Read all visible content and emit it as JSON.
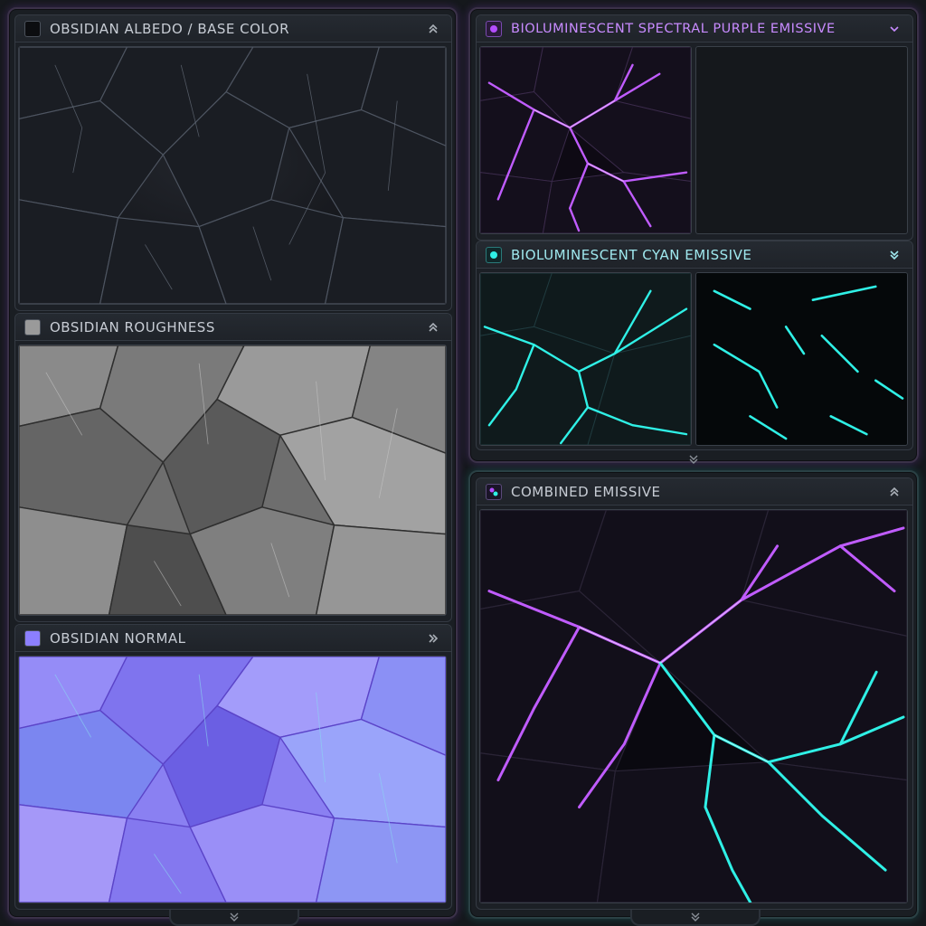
{
  "panels": {
    "albedo": {
      "title": "OBSIDIAN ALBEDO / BASE COLOR",
      "swatch_color": "#0c0d10",
      "icon": "chevron-up-double-icon"
    },
    "roughness": {
      "title": "OBSIDIAN ROUGHNESS",
      "swatch_color": "#9a9a9a",
      "icon": "chevron-up-double-icon"
    },
    "normal": {
      "title": "OBSIDIAN NORMAL",
      "swatch_color": "#8c7fff",
      "icon": "chevron-right-double-icon"
    },
    "purple": {
      "title": "BIOLUMINESCENT SPECTRAL PURPLE EMISSIVE",
      "title_color": "#c88bff",
      "icon": "chevron-down-icon"
    },
    "cyan": {
      "title": "BIOLUMINESCENT CYAN EMISSIVE",
      "title_color": "#9fe8ee",
      "icon": "chevron-down-double-icon"
    },
    "combined": {
      "title": "COMBINED EMISSIVE",
      "title_color": "#c7ccd4",
      "icon": "chevron-up-double-icon"
    }
  },
  "colors": {
    "accent_purple": "#b44dff",
    "accent_cyan": "#2ff0e6",
    "frame": "#2c323a"
  }
}
